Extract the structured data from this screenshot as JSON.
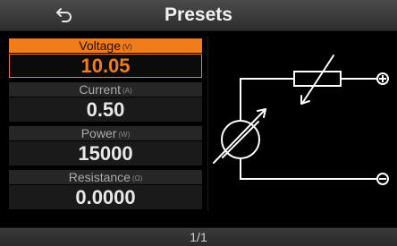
{
  "header": {
    "title": "Presets",
    "back_icon": "back-arrow-icon"
  },
  "params": [
    {
      "label": "Voltage",
      "unit": "(V)",
      "value": "10.05",
      "selected": true
    },
    {
      "label": "Current",
      "unit": "(A)",
      "value": "0.50",
      "selected": false
    },
    {
      "label": "Power",
      "unit": "(W)",
      "value": "15000",
      "selected": false
    },
    {
      "label": "Resistance",
      "unit": "(Ω)",
      "value": "0.0000",
      "selected": false
    }
  ],
  "diagram": {
    "icons": [
      "voltage-source-icon",
      "variable-resistor-icon",
      "positive-terminal-icon",
      "negative-terminal-icon"
    ]
  },
  "footer": {
    "page": "1/1"
  },
  "colors": {
    "accent": "#f07c1a",
    "header_bg": "#3a3a3a",
    "background": "#000000"
  }
}
